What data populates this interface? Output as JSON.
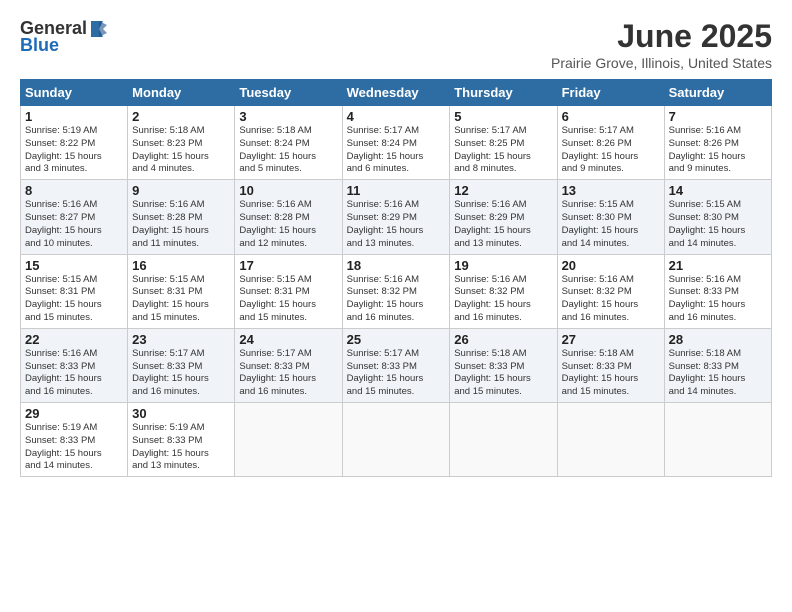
{
  "logo": {
    "general": "General",
    "blue": "Blue"
  },
  "title": {
    "month": "June 2025",
    "location": "Prairie Grove, Illinois, United States"
  },
  "weekdays": [
    "Sunday",
    "Monday",
    "Tuesday",
    "Wednesday",
    "Thursday",
    "Friday",
    "Saturday"
  ],
  "weeks": [
    [
      {
        "day": "1",
        "info": "Sunrise: 5:19 AM\nSunset: 8:22 PM\nDaylight: 15 hours\nand 3 minutes."
      },
      {
        "day": "2",
        "info": "Sunrise: 5:18 AM\nSunset: 8:23 PM\nDaylight: 15 hours\nand 4 minutes."
      },
      {
        "day": "3",
        "info": "Sunrise: 5:18 AM\nSunset: 8:24 PM\nDaylight: 15 hours\nand 5 minutes."
      },
      {
        "day": "4",
        "info": "Sunrise: 5:17 AM\nSunset: 8:24 PM\nDaylight: 15 hours\nand 6 minutes."
      },
      {
        "day": "5",
        "info": "Sunrise: 5:17 AM\nSunset: 8:25 PM\nDaylight: 15 hours\nand 8 minutes."
      },
      {
        "day": "6",
        "info": "Sunrise: 5:17 AM\nSunset: 8:26 PM\nDaylight: 15 hours\nand 9 minutes."
      },
      {
        "day": "7",
        "info": "Sunrise: 5:16 AM\nSunset: 8:26 PM\nDaylight: 15 hours\nand 9 minutes."
      }
    ],
    [
      {
        "day": "8",
        "info": "Sunrise: 5:16 AM\nSunset: 8:27 PM\nDaylight: 15 hours\nand 10 minutes."
      },
      {
        "day": "9",
        "info": "Sunrise: 5:16 AM\nSunset: 8:28 PM\nDaylight: 15 hours\nand 11 minutes."
      },
      {
        "day": "10",
        "info": "Sunrise: 5:16 AM\nSunset: 8:28 PM\nDaylight: 15 hours\nand 12 minutes."
      },
      {
        "day": "11",
        "info": "Sunrise: 5:16 AM\nSunset: 8:29 PM\nDaylight: 15 hours\nand 13 minutes."
      },
      {
        "day": "12",
        "info": "Sunrise: 5:16 AM\nSunset: 8:29 PM\nDaylight: 15 hours\nand 13 minutes."
      },
      {
        "day": "13",
        "info": "Sunrise: 5:15 AM\nSunset: 8:30 PM\nDaylight: 15 hours\nand 14 minutes."
      },
      {
        "day": "14",
        "info": "Sunrise: 5:15 AM\nSunset: 8:30 PM\nDaylight: 15 hours\nand 14 minutes."
      }
    ],
    [
      {
        "day": "15",
        "info": "Sunrise: 5:15 AM\nSunset: 8:31 PM\nDaylight: 15 hours\nand 15 minutes."
      },
      {
        "day": "16",
        "info": "Sunrise: 5:15 AM\nSunset: 8:31 PM\nDaylight: 15 hours\nand 15 minutes."
      },
      {
        "day": "17",
        "info": "Sunrise: 5:15 AM\nSunset: 8:31 PM\nDaylight: 15 hours\nand 15 minutes."
      },
      {
        "day": "18",
        "info": "Sunrise: 5:16 AM\nSunset: 8:32 PM\nDaylight: 15 hours\nand 16 minutes."
      },
      {
        "day": "19",
        "info": "Sunrise: 5:16 AM\nSunset: 8:32 PM\nDaylight: 15 hours\nand 16 minutes."
      },
      {
        "day": "20",
        "info": "Sunrise: 5:16 AM\nSunset: 8:32 PM\nDaylight: 15 hours\nand 16 minutes."
      },
      {
        "day": "21",
        "info": "Sunrise: 5:16 AM\nSunset: 8:33 PM\nDaylight: 15 hours\nand 16 minutes."
      }
    ],
    [
      {
        "day": "22",
        "info": "Sunrise: 5:16 AM\nSunset: 8:33 PM\nDaylight: 15 hours\nand 16 minutes."
      },
      {
        "day": "23",
        "info": "Sunrise: 5:17 AM\nSunset: 8:33 PM\nDaylight: 15 hours\nand 16 minutes."
      },
      {
        "day": "24",
        "info": "Sunrise: 5:17 AM\nSunset: 8:33 PM\nDaylight: 15 hours\nand 16 minutes."
      },
      {
        "day": "25",
        "info": "Sunrise: 5:17 AM\nSunset: 8:33 PM\nDaylight: 15 hours\nand 15 minutes."
      },
      {
        "day": "26",
        "info": "Sunrise: 5:18 AM\nSunset: 8:33 PM\nDaylight: 15 hours\nand 15 minutes."
      },
      {
        "day": "27",
        "info": "Sunrise: 5:18 AM\nSunset: 8:33 PM\nDaylight: 15 hours\nand 15 minutes."
      },
      {
        "day": "28",
        "info": "Sunrise: 5:18 AM\nSunset: 8:33 PM\nDaylight: 15 hours\nand 14 minutes."
      }
    ],
    [
      {
        "day": "29",
        "info": "Sunrise: 5:19 AM\nSunset: 8:33 PM\nDaylight: 15 hours\nand 14 minutes."
      },
      {
        "day": "30",
        "info": "Sunrise: 5:19 AM\nSunset: 8:33 PM\nDaylight: 15 hours\nand 13 minutes."
      },
      {
        "day": "",
        "info": ""
      },
      {
        "day": "",
        "info": ""
      },
      {
        "day": "",
        "info": ""
      },
      {
        "day": "",
        "info": ""
      },
      {
        "day": "",
        "info": ""
      }
    ]
  ]
}
